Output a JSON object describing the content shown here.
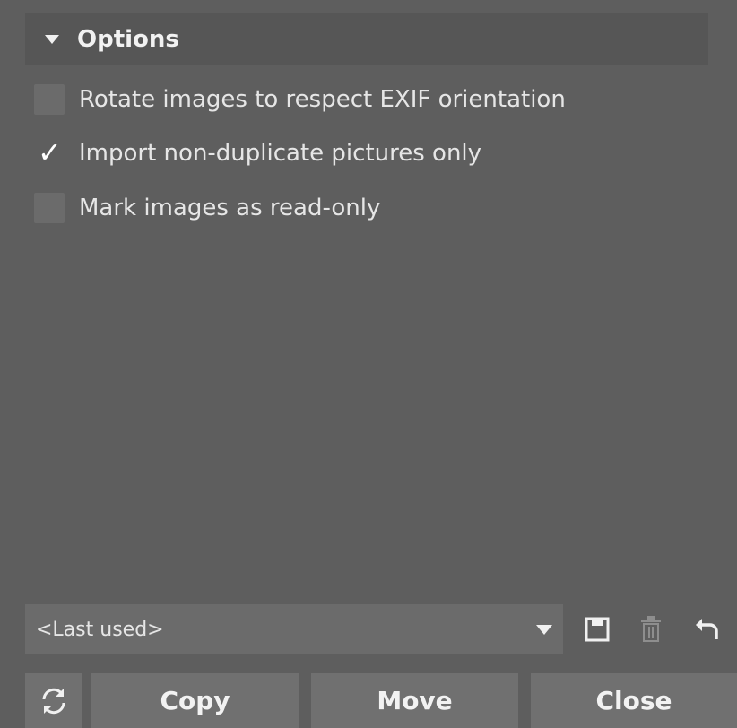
{
  "options": {
    "title": "Options",
    "items": [
      {
        "label": "Rotate images to respect EXIF orientation",
        "checked": false
      },
      {
        "label": "Import non-duplicate pictures only",
        "checked": true
      },
      {
        "label": "Mark images as read-only",
        "checked": false
      }
    ]
  },
  "presets": {
    "selected": "<Last used>",
    "save_icon": "save-icon",
    "delete_icon": "trash-icon",
    "reset_icon": "undo-icon"
  },
  "actions": {
    "reload_icon": "refresh-icon",
    "copy_label": "Copy",
    "move_label": "Move",
    "close_label": "Close"
  },
  "colors": {
    "background": "#5e5e5e",
    "header": "#565656",
    "control": "#6b6b6b",
    "button": "#707070"
  }
}
